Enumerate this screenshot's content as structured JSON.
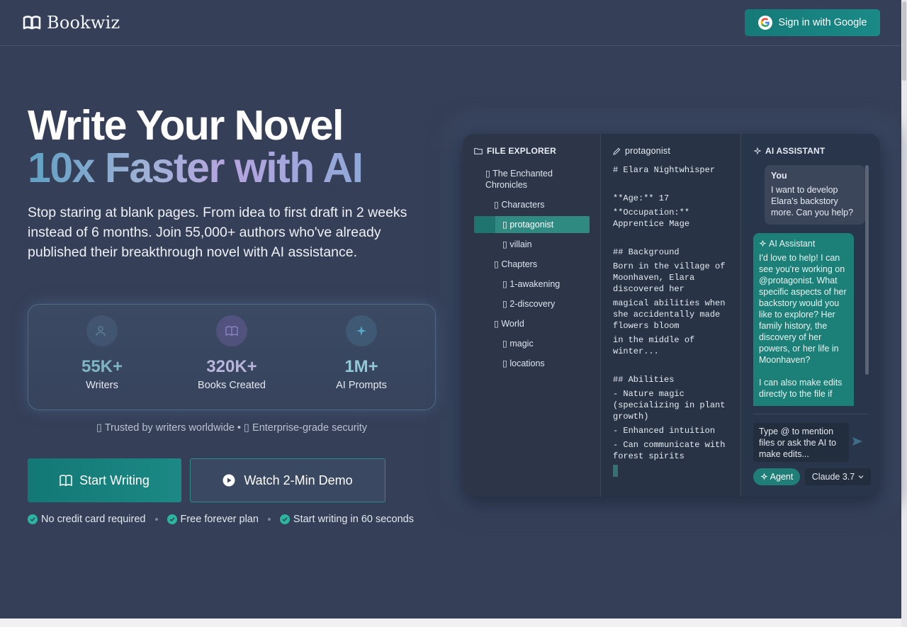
{
  "brand": {
    "name": "Bookwiz"
  },
  "header": {
    "signin_label": "Sign in with Google"
  },
  "hero": {
    "title_line1": "Write Your Novel",
    "title_line2": "10x Faster with AI",
    "lead": "Stop staring at blank pages. From idea to first draft in 2 weeks instead of 6 months. Join 55,000+ authors who've already published their breakthrough novel with AI assistance."
  },
  "stats": [
    {
      "icon": "users-icon",
      "value": "55K+",
      "label": "Writers",
      "color": "#7fb6c4"
    },
    {
      "icon": "book-icon",
      "value": "320K+",
      "label": "Books Created",
      "color": "#b8b4dc"
    },
    {
      "icon": "sparkles-icon",
      "value": "1M+",
      "label": "AI Prompts",
      "color": "#8fc9d8"
    }
  ],
  "trusted": "▯ Trusted by writers worldwide • ▯ Enterprise-grade security",
  "cta": {
    "start_label": "Start Writing",
    "demo_label": "Watch 2-Min Demo"
  },
  "checks": [
    "No credit card required",
    "Free forever plan",
    "Start writing in 60 seconds"
  ],
  "app": {
    "files_title": "FILE EXPLORER",
    "tree": [
      {
        "label": "▯ The Enchanted",
        "label2": "Chronicles"
      },
      {
        "label": "▯ Characters"
      },
      {
        "label": "▯ protagonist"
      },
      {
        "label": "▯ villain"
      },
      {
        "label": "▯ Chapters"
      },
      {
        "label": "▯ 1-awakening"
      },
      {
        "label": "▯ 2-discovery"
      },
      {
        "label": "▯ World"
      },
      {
        "label": "▯ magic"
      },
      {
        "label": "▯ locations"
      }
    ],
    "editor_title": "protagonist",
    "code": [
      "# Elara Nightwhisper",
      "**Age:** 17",
      "**Occupation:**\nApprentice Mage",
      "## Background",
      "Born in the village of\nMoonhaven, Elara\ndiscovered her",
      "magical abilities when\nshe accidentally made\nflowers bloom",
      "in the middle of\nwinter...",
      "## Abilities",
      "- Nature magic\n(specializing in plant\ngrowth)",
      "- Enhanced intuition",
      "- Can communicate with\nforest spirits"
    ],
    "ai_title": "AI ASSISTANT",
    "user_name": "You",
    "user_msg": "I want to develop Elara's backstory more. Can you help?",
    "ai_name": "AI Assistant",
    "ai_msg": "I'd love to help! I can see you're working on @protagonist. What specific aspects of her backstory would you like to explore? Her family history, the discovery of her powers, or her life in Moonhaven?",
    "ai_msg2": "I can also make edits directly to the file if",
    "input_placeholder": "Type @ to mention files or ask the AI to make edits...",
    "agent_label": "Agent",
    "model_label": "Claude 3.7"
  }
}
